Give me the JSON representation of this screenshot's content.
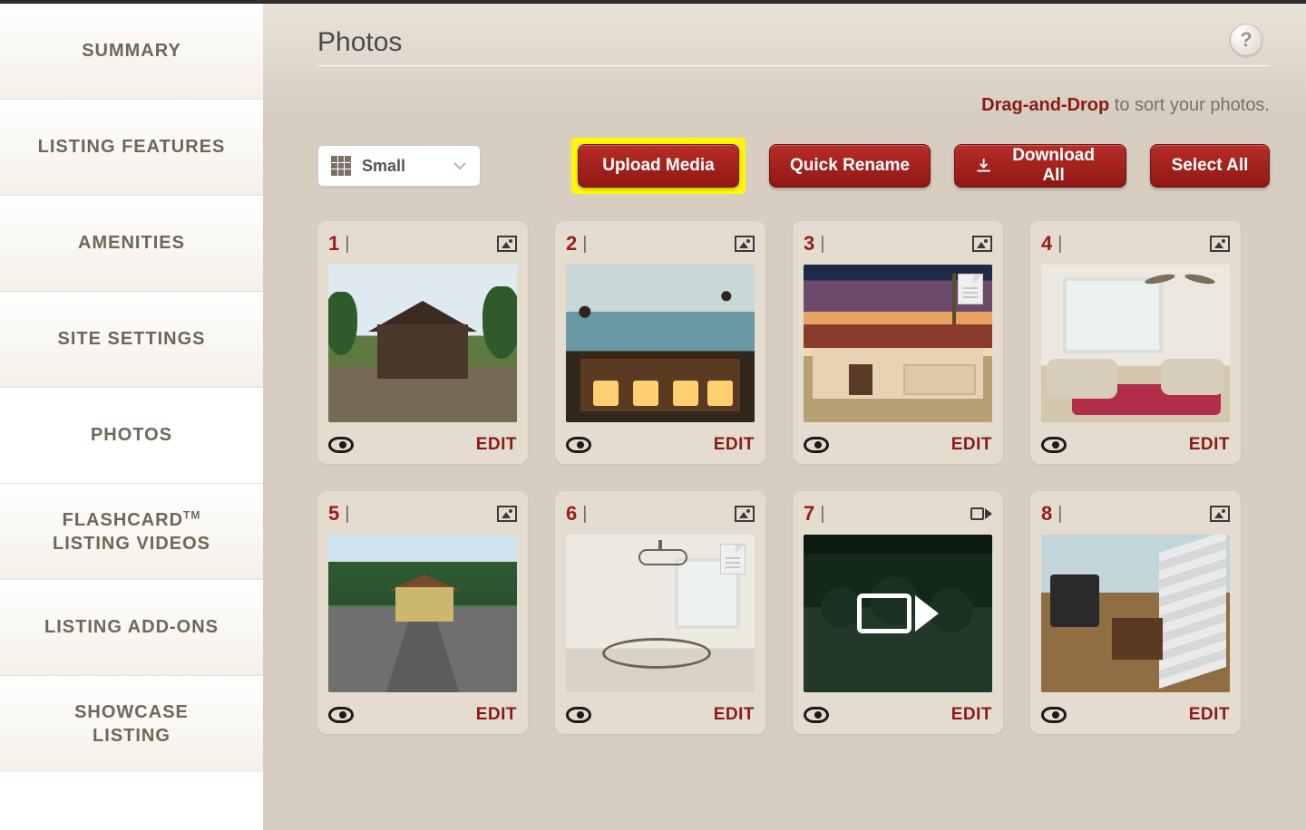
{
  "sidebar": {
    "items": [
      {
        "label": "SUMMARY"
      },
      {
        "label": "LISTING FEATURES"
      },
      {
        "label": "AMENITIES"
      },
      {
        "label": "SITE SETTINGS"
      },
      {
        "label": "PHOTOS"
      },
      {
        "label_line1": "FLASHCARD",
        "label_tm": "TM",
        "label_line2": "LISTING VIDEOS"
      },
      {
        "label": "LISTING ADD-ONS"
      },
      {
        "label_line1": "SHOWCASE",
        "label_line2": "LISTING"
      }
    ],
    "active_index": 4
  },
  "page": {
    "title": "Photos",
    "help_tooltip": "?"
  },
  "drag_hint": {
    "bold": "Drag-and-Drop",
    "rest": " to sort your photos."
  },
  "toolbar": {
    "size_label": "Small",
    "upload": "Upload Media",
    "quick_rename": "Quick Rename",
    "download_all": "Download All",
    "select_all": "Select All"
  },
  "cards": [
    {
      "num": "1",
      "type": "image",
      "has_doc": false,
      "edit": "EDIT"
    },
    {
      "num": "2",
      "type": "image",
      "has_doc": false,
      "edit": "EDIT"
    },
    {
      "num": "3",
      "type": "image",
      "has_doc": true,
      "edit": "EDIT"
    },
    {
      "num": "4",
      "type": "image",
      "has_doc": false,
      "edit": "EDIT"
    },
    {
      "num": "5",
      "type": "image",
      "has_doc": false,
      "edit": "EDIT"
    },
    {
      "num": "6",
      "type": "image",
      "has_doc": true,
      "edit": "EDIT"
    },
    {
      "num": "7",
      "type": "video",
      "has_doc": false,
      "edit": "EDIT"
    },
    {
      "num": "8",
      "type": "image",
      "has_doc": false,
      "edit": "EDIT"
    }
  ]
}
